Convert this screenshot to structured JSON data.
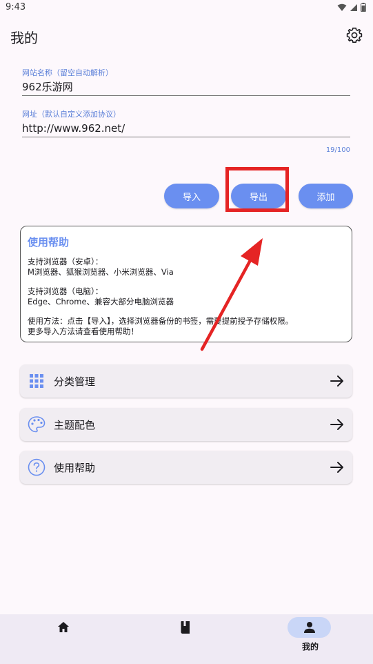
{
  "status": {
    "time": "9:43"
  },
  "header": {
    "title": "我的"
  },
  "form": {
    "name_label": "网站名称（留空自动解析）",
    "name_value": "962乐游网",
    "url_label": "网址（默认自定义添加协议）",
    "url_value": "http://www.962.net/",
    "counter": "19/100"
  },
  "actions": {
    "import_label": "导入",
    "export_label": "导出",
    "add_label": "添加"
  },
  "help": {
    "title": "使用帮助",
    "lines": [
      "支持浏览器（安卓）：",
      "M浏览器、狐猴浏览器、小米浏览器、Via",
      "支持浏览器（电脑）：",
      "Edge、Chrome、兼容大部分电脑浏览器",
      "使用方法：点击【导入】，选择浏览器备份的书签，需要提前授予存储权限。",
      "更多导入方法请查看使用帮助！"
    ]
  },
  "menu": {
    "items": [
      {
        "label": "分类管理",
        "icon": "grid-icon"
      },
      {
        "label": "主题配色",
        "icon": "palette-icon"
      },
      {
        "label": "使用帮助",
        "icon": "help-icon"
      }
    ]
  },
  "nav": {
    "items": [
      {
        "label": "",
        "icon": "home-icon"
      },
      {
        "label": "",
        "icon": "book-icon"
      },
      {
        "label": "我的",
        "icon": "person-icon"
      }
    ],
    "active_color": "#c9d6f7"
  },
  "colors": {
    "accent": "#6a8ff0",
    "highlight": "#e52424",
    "background": "#fdf8fc"
  }
}
